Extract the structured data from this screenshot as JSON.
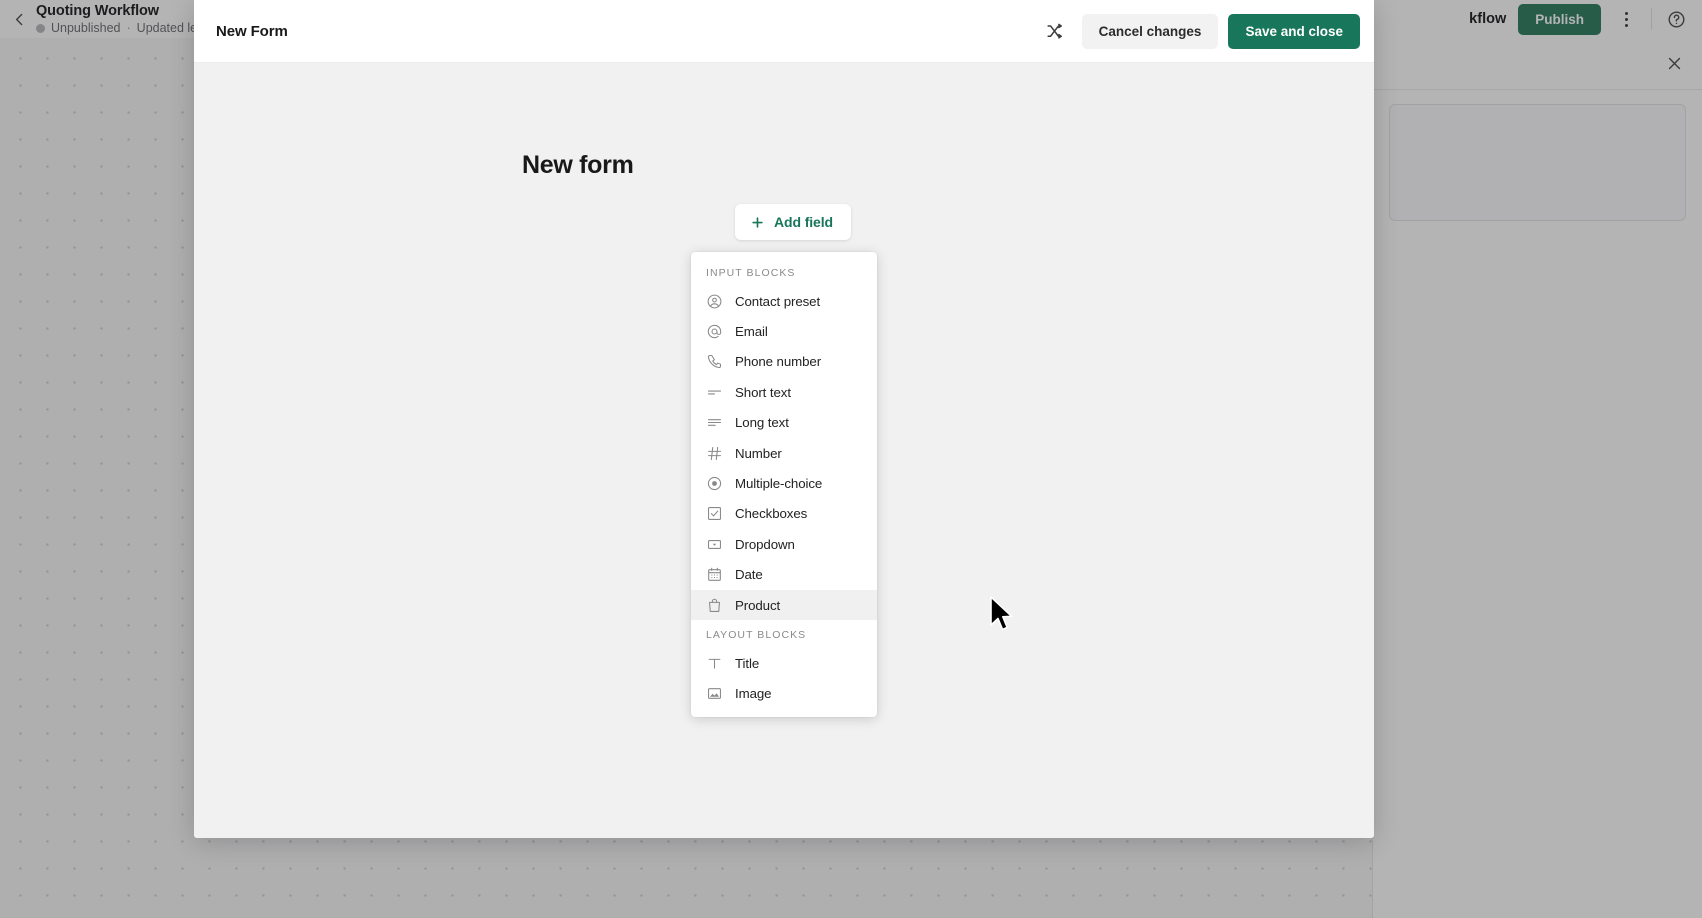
{
  "background": {
    "back_icon": "chevron-left-icon",
    "workflow_title": "Quoting Workflow",
    "status": "Unpublished",
    "separator": "·",
    "updated_text": "Updated less t",
    "workflow_tab_label": "kflow",
    "publish_label": "Publish",
    "kebab_icon": "more-vertical-icon",
    "help_icon": "help-circle-icon",
    "close_icon": "close-icon"
  },
  "modal": {
    "title": "New Form",
    "shuffle_icon": "shuffle-icon",
    "cancel_label": "Cancel changes",
    "save_label": "Save and close",
    "form_title": "New form",
    "add_field_label": "Add field",
    "add_field_icon": "plus-icon",
    "accent_green": "#18765a",
    "cancel_bg": "#f2f2f2",
    "body_bg": "#f1f1f1"
  },
  "block_menu": {
    "sections": [
      {
        "label": "INPUT BLOCKS",
        "items": [
          {
            "label": "Contact preset",
            "icon": "user-circle-icon",
            "hovered": false
          },
          {
            "label": "Email",
            "icon": "at-sign-icon",
            "hovered": false
          },
          {
            "label": "Phone number",
            "icon": "phone-icon",
            "hovered": false
          },
          {
            "label": "Short text",
            "icon": "short-text-icon",
            "hovered": false
          },
          {
            "label": "Long text",
            "icon": "long-text-icon",
            "hovered": false
          },
          {
            "label": "Number",
            "icon": "hash-icon",
            "hovered": false
          },
          {
            "label": "Multiple-choice",
            "icon": "radio-button-icon",
            "hovered": false
          },
          {
            "label": "Checkboxes",
            "icon": "checkbox-icon",
            "hovered": false
          },
          {
            "label": "Dropdown",
            "icon": "dropdown-icon",
            "hovered": false
          },
          {
            "label": "Date",
            "icon": "calendar-icon",
            "hovered": false
          },
          {
            "label": "Product",
            "icon": "shopping-bag-icon",
            "hovered": true
          }
        ]
      },
      {
        "label": "LAYOUT BLOCKS",
        "items": [
          {
            "label": "Title",
            "icon": "text-title-icon",
            "hovered": false
          },
          {
            "label": "Image",
            "icon": "image-icon",
            "hovered": false
          }
        ]
      }
    ]
  }
}
